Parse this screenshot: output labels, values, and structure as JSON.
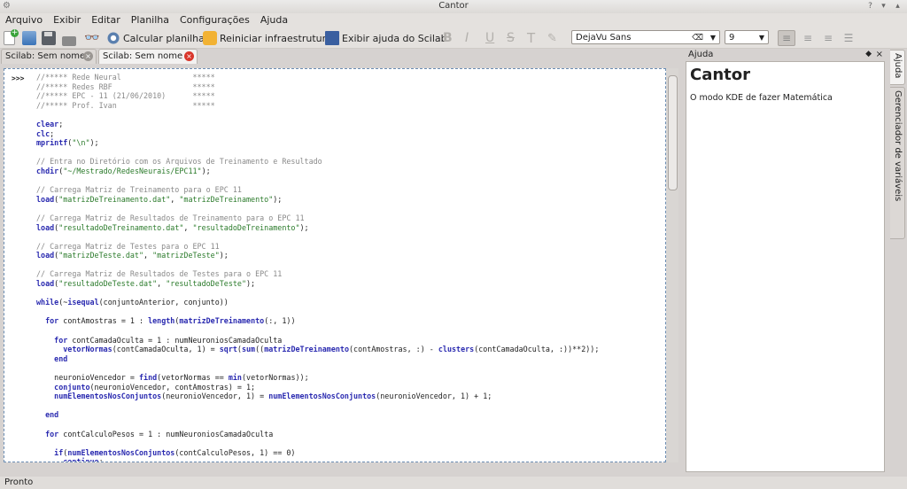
{
  "window": {
    "title": "Cantor"
  },
  "menu": [
    "Arquivo",
    "Exibir",
    "Editar",
    "Planilha",
    "Configurações",
    "Ajuda"
  ],
  "toolbar": {
    "calc_label": "Calcular planilha",
    "restart_label": "Reiniciar infraestrutura",
    "show_help_label": "Exibir ajuda do Scilab",
    "font_name": "DejaVu Sans",
    "font_size": "9"
  },
  "tabs": [
    {
      "label": "Scilab: Sem nome",
      "active": false
    },
    {
      "label": "Scilab: Sem nome",
      "active": true
    }
  ],
  "worksheet": {
    "prompt": ">>>",
    "lines": [
      [
        [
          "cmt",
          "//***** Rede Neural                *****"
        ]
      ],
      [
        [
          "cmt",
          "//***** Redes RBF                  *****"
        ]
      ],
      [
        [
          "cmt",
          "//***** EPC - 11 (21/06/2010)      *****"
        ]
      ],
      [
        [
          "cmt",
          "//***** Prof. Ivan                 *****"
        ]
      ],
      [],
      [
        [
          "kw",
          "clear"
        ],
        [
          "",
          ";"
        ]
      ],
      [
        [
          "kw",
          "clc"
        ],
        [
          "",
          ";"
        ]
      ],
      [
        [
          "kw",
          "mprintf"
        ],
        [
          "",
          "("
        ],
        [
          "str",
          "\"\\n\""
        ],
        [
          "",
          ");"
        ]
      ],
      [],
      [
        [
          "cmt",
          "// Entra no Diretório com os Arquivos de Treinamento e Resultado"
        ]
      ],
      [
        [
          "kw",
          "chdir"
        ],
        [
          "",
          "("
        ],
        [
          "str",
          "\"~/Mestrado/RedesNeurais/EPC11\""
        ],
        [
          "",
          ");"
        ]
      ],
      [],
      [
        [
          "cmt",
          "// Carrega Matriz de Treinamento para o EPC 11"
        ]
      ],
      [
        [
          "kw",
          "load"
        ],
        [
          "",
          "("
        ],
        [
          "str",
          "\"matrizDeTreinamento.dat\""
        ],
        [
          "",
          ", "
        ],
        [
          "str",
          "\"matrizDeTreinamento\""
        ],
        [
          "",
          ");"
        ]
      ],
      [],
      [
        [
          "cmt",
          "// Carrega Matriz de Resultados de Treinamento para o EPC 11"
        ]
      ],
      [
        [
          "kw",
          "load"
        ],
        [
          "",
          "("
        ],
        [
          "str",
          "\"resultadoDeTreinamento.dat\""
        ],
        [
          "",
          ", "
        ],
        [
          "str",
          "\"resultadoDeTreinamento\""
        ],
        [
          "",
          ");"
        ]
      ],
      [],
      [
        [
          "cmt",
          "// Carrega Matriz de Testes para o EPC 11"
        ]
      ],
      [
        [
          "kw",
          "load"
        ],
        [
          "",
          "("
        ],
        [
          "str",
          "\"matrizDeTeste.dat\""
        ],
        [
          "",
          ", "
        ],
        [
          "str",
          "\"matrizDeTeste\""
        ],
        [
          "",
          ");"
        ]
      ],
      [],
      [
        [
          "cmt",
          "// Carrega Matriz de Resultados de Testes para o EPC 11"
        ]
      ],
      [
        [
          "kw",
          "load"
        ],
        [
          "",
          "("
        ],
        [
          "str",
          "\"resultadoDeTeste.dat\""
        ],
        [
          "",
          ", "
        ],
        [
          "str",
          "\"resultadoDeTeste\""
        ],
        [
          "",
          ");"
        ]
      ],
      [],
      [
        [
          "kw",
          "while"
        ],
        [
          "",
          "(~"
        ],
        [
          "kw",
          "isequal"
        ],
        [
          "",
          "(conjuntoAnterior, conjunto))"
        ]
      ],
      [],
      [
        [
          "",
          "  "
        ],
        [
          "kw",
          "for"
        ],
        [
          "",
          " contAmostras = 1 : "
        ],
        [
          "kw",
          "length"
        ],
        [
          "",
          "("
        ],
        [
          "kw",
          "matrizDeTreinamento"
        ],
        [
          "",
          "(:, 1))"
        ]
      ],
      [],
      [
        [
          "",
          "    "
        ],
        [
          "kw",
          "for"
        ],
        [
          "",
          " contCamadaOculta = 1 : numNeuroniosCamadaOculta"
        ]
      ],
      [
        [
          "",
          "      "
        ],
        [
          "kw",
          "vetorNormas"
        ],
        [
          "",
          "(contCamadaOculta, 1) = "
        ],
        [
          "kw",
          "sqrt"
        ],
        [
          "",
          "("
        ],
        [
          "kw",
          "sum"
        ],
        [
          "",
          "(("
        ],
        [
          "kw",
          "matrizDeTreinamento"
        ],
        [
          "",
          "(contAmostras, :) - "
        ],
        [
          "kw",
          "clusters"
        ],
        [
          "",
          "(contCamadaOculta, :))**2));"
        ]
      ],
      [
        [
          "",
          "    "
        ],
        [
          "kw",
          "end"
        ]
      ],
      [],
      [
        [
          "",
          "    neuronioVencedor = "
        ],
        [
          "kw",
          "find"
        ],
        [
          "",
          "(vetorNormas == "
        ],
        [
          "kw",
          "min"
        ],
        [
          "",
          "(vetorNormas));"
        ]
      ],
      [
        [
          "",
          "    "
        ],
        [
          "kw",
          "conjunto"
        ],
        [
          "",
          "(neuronioVencedor, contAmostras) = 1;"
        ]
      ],
      [
        [
          "",
          "    "
        ],
        [
          "kw",
          "numElementosNosConjuntos"
        ],
        [
          "",
          "(neuronioVencedor, 1) = "
        ],
        [
          "kw",
          "numElementosNosConjuntos"
        ],
        [
          "",
          "(neuronioVencedor, 1) + 1;"
        ]
      ],
      [],
      [
        [
          "",
          "  "
        ],
        [
          "kw",
          "end"
        ]
      ],
      [],
      [
        [
          "",
          "  "
        ],
        [
          "kw",
          "for"
        ],
        [
          "",
          " contCalculoPesos = 1 : numNeuroniosCamadaOculta"
        ]
      ],
      [],
      [
        [
          "",
          "    "
        ],
        [
          "kw",
          "if"
        ],
        [
          "",
          "("
        ],
        [
          "kw",
          "numElementosNosConjuntos"
        ],
        [
          "",
          "(contCalculoPesos, 1) == 0)"
        ]
      ],
      [
        [
          "",
          "      "
        ],
        [
          "kw",
          "continue"
        ],
        [
          "",
          ";"
        ]
      ]
    ]
  },
  "help_panel": {
    "dock_title": "Ajuda",
    "heading": "Cantor",
    "text": "O modo KDE de fazer Matemática"
  },
  "side_tabs": [
    "Ajuda",
    "Gerenciador de variáveis"
  ],
  "status": "Pronto",
  "colors": {
    "accent": "#3a73b8",
    "close_red": "#d9362b",
    "keyword": "#2a2ab0",
    "string": "#2a7a2a",
    "comment": "#8a8a8a"
  }
}
